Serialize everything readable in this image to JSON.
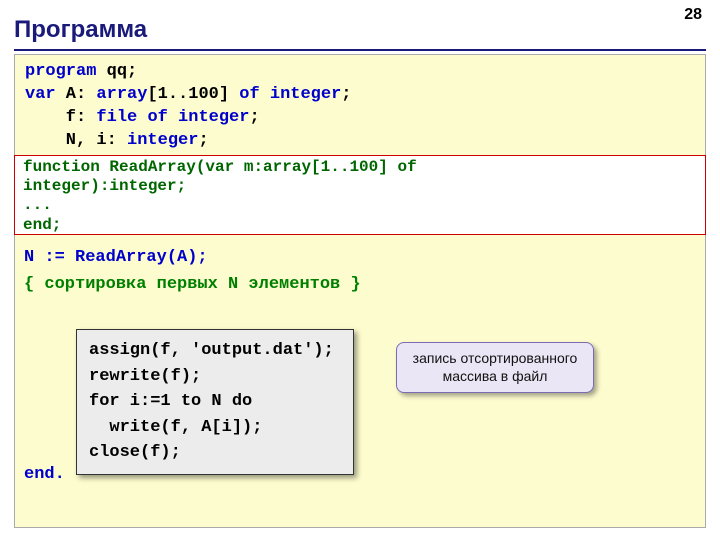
{
  "pageNumber": "28",
  "title": "Программа",
  "code": {
    "l1a": "program",
    "l1b": " qq;",
    "l2a": "var",
    "l2b": " A: ",
    "l2c": "array",
    "l2d": "[1..100] ",
    "l2e": "of",
    "l2f": " ",
    "l2g": "integer",
    "l2h": ";",
    "l3a": "    f: ",
    "l3b": "file",
    "l3c": " ",
    "l3d": "of",
    "l3e": " ",
    "l3f": "integer",
    "l3g": ";",
    "l4a": "    N, i: ",
    "l4b": "integer",
    "l4c": ";"
  },
  "redBox": {
    "l1": "function ReadArray(var m:array[1..100] of",
    "l2": "integer):integer;",
    "l3": "...",
    "l4": "end;"
  },
  "after": {
    "l1a": "   N := ReadArray(A);",
    "l2": "   { сортировка первых N элементов }"
  },
  "innerBox": {
    "l1": "assign(f, 'output.dat');",
    "l2": "rewrite(f);",
    "l3": "for i:=1 to N do",
    "l4": "  write(f, A[i]);",
    "l5": "close(f);"
  },
  "callout": "запись отсортированного массива в файл",
  "endDot": "end."
}
